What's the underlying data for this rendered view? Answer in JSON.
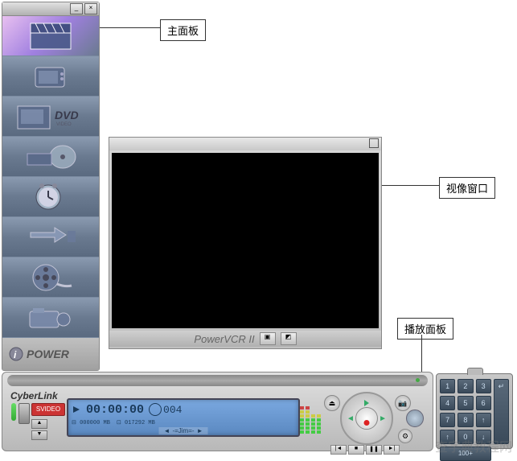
{
  "callouts": {
    "main_panel": "主面板",
    "video_window": "视像窗口",
    "play_panel": "播放面板"
  },
  "sidebar": {
    "items": [
      {
        "name": "capture",
        "icon": "clapperboard"
      },
      {
        "name": "tv",
        "icon": "television"
      },
      {
        "name": "dvd",
        "icon": "dvd",
        "label": "DVD"
      },
      {
        "name": "disc",
        "icon": "disc-tray"
      },
      {
        "name": "schedule",
        "icon": "clock"
      },
      {
        "name": "transfer",
        "icon": "arrows"
      },
      {
        "name": "reel",
        "icon": "film-reel"
      },
      {
        "name": "camera",
        "icon": "camcorder"
      }
    ],
    "power_label": "POWER"
  },
  "video": {
    "brand": "PowerVCR II"
  },
  "control": {
    "brand": "CyberLink",
    "svideo_label": "SVIDEO",
    "lcd": {
      "time": "00:00:00",
      "counter": "004",
      "size1": "000000",
      "size1_unit": "MB",
      "size2": "017292",
      "size2_unit": "MB",
      "user": "-=Jim=-"
    }
  },
  "keypad": {
    "keys": [
      "1",
      "2",
      "3",
      "4",
      "5",
      "6",
      "7",
      "8",
      "↑",
      "0",
      "↓",
      "100+"
    ],
    "extra": "↵"
  },
  "watermark": {
    "main": "查字典教程网",
    "sub": "jiaocheng.chazidian.com"
  }
}
